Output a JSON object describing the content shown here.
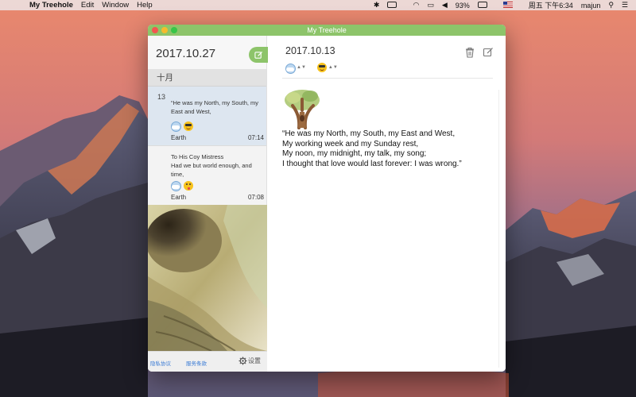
{
  "menubar": {
    "app_name": "My Treehole",
    "menus": [
      "Edit",
      "Window",
      "Help"
    ],
    "battery": "93%",
    "clock": "周五 下午6:34",
    "user": "majun"
  },
  "window": {
    "title": "My Treehole",
    "accent_color": "#8dc46a"
  },
  "sidebar": {
    "header_date": "2017.10.27",
    "month_label": "十月",
    "entries": [
      {
        "day": "13",
        "text": "“He was my North, my South, my East and West,",
        "weather_icon": "cloudy-weather-icon",
        "mood_icon": "sunglasses-emoji-icon",
        "place": "Earth",
        "time": "07:14"
      },
      {
        "day": "",
        "text": "To His Coy Mistress\nHad we but world enough, and time,",
        "weather_icon": "cloudy-weather-icon",
        "mood_icon": "tongue-out-emoji-icon",
        "place": "Earth",
        "time": "07:08"
      }
    ],
    "footer": {
      "privacy": "隐私协议",
      "terms": "服务条款",
      "settings": "设置"
    }
  },
  "main": {
    "date": "2017.10.13",
    "weather_icon": "cloudy-weather-icon",
    "mood_icon": "sunglasses-emoji-icon",
    "body_lines": [
      "“He was my North, my South, my East and West,",
      "My working week and my Sunday rest,",
      "My noon, my midnight, my talk, my song;",
      "I thought that love would last forever: I was wrong.”"
    ]
  }
}
